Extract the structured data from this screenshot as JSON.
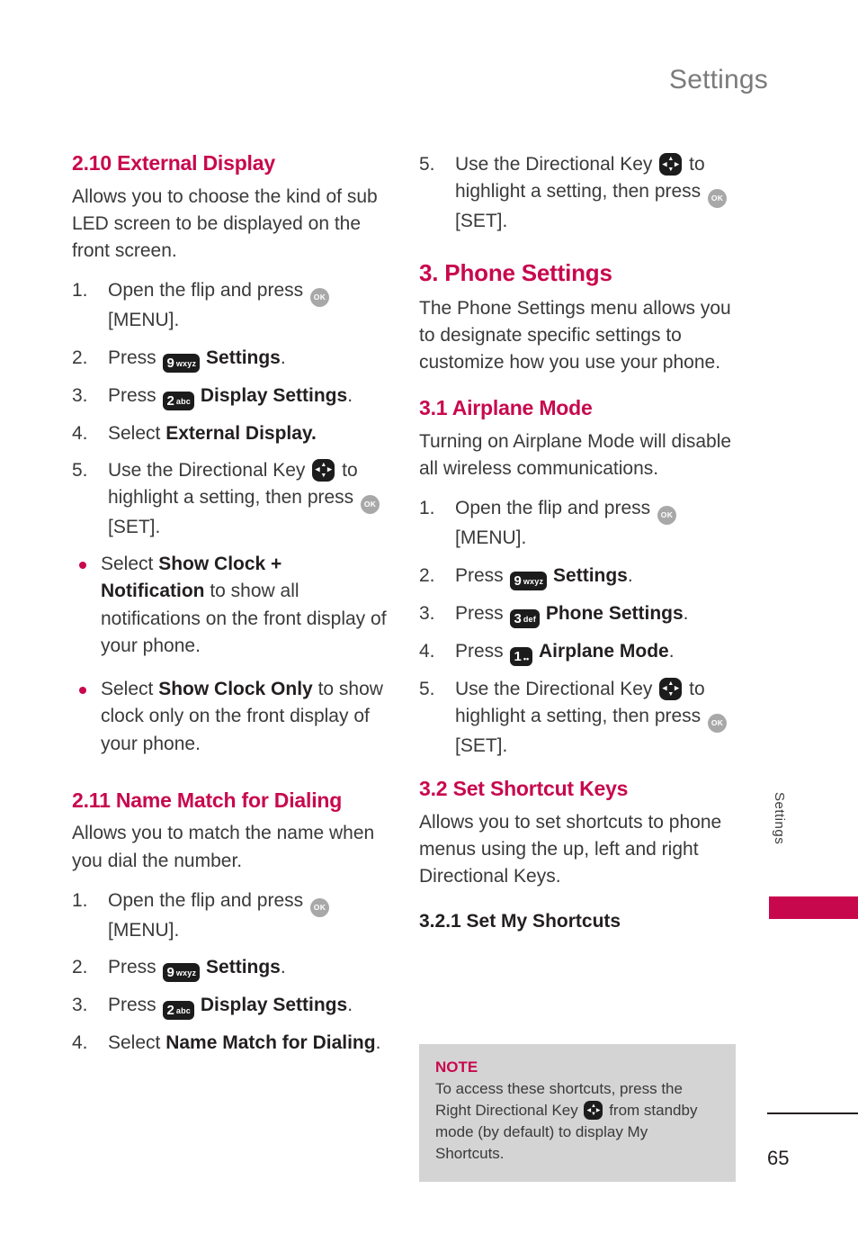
{
  "header": {
    "title": "Settings"
  },
  "side_tab": {
    "label": "Settings",
    "block_color": "#c8084d"
  },
  "footer": {
    "page_number": "65"
  },
  "icons": {
    "ok_key": "OK",
    "key9": {
      "digit": "9",
      "letters": "wxyz"
    },
    "key2": {
      "digit": "2",
      "letters": "abc"
    },
    "key3": {
      "digit": "3",
      "letters": "def"
    },
    "key1": {
      "digit": "1",
      "letters": "••"
    }
  },
  "left_column": {
    "section_210": {
      "heading": "2.10 External Display",
      "intro": "Allows you to choose the kind of sub LED screen to be displayed on the front screen.",
      "steps": [
        {
          "num": "1.",
          "pre": "Open the flip and press ",
          "icon": "ok",
          "post": " [MENU]."
        },
        {
          "num": "2.",
          "pre": "Press ",
          "icon": "key9",
          "post": " ",
          "bold": "Settings",
          "tail": "."
        },
        {
          "num": "3.",
          "pre": "Press ",
          "icon": "key2",
          "post": " ",
          "bold": "Display Settings",
          "tail": "."
        },
        {
          "num": "4.",
          "pre": "Select ",
          "icon": "none",
          "bold": "External Display.",
          "tail": ""
        },
        {
          "num": "5.",
          "pre": "Use the Directional Key ",
          "icon": "dir",
          "post": " to highlight a setting, then press ",
          "icon2": "ok",
          "post2": " [SET]."
        }
      ],
      "bullets": [
        {
          "pre": "Select ",
          "bold": "Show Clock + Notification",
          "post": " to show all notifications on the front display of your phone."
        },
        {
          "pre": "Select ",
          "bold": "Show Clock Only",
          "post": " to show clock only on the front display of your phone."
        }
      ]
    },
    "section_211": {
      "heading": "2.11 Name Match for Dialing",
      "intro": "Allows you to match the name when you dial the number.",
      "steps": [
        {
          "num": "1.",
          "pre": "Open the flip and press ",
          "icon": "ok",
          "post": " [MENU]."
        },
        {
          "num": "2.",
          "pre": "Press ",
          "icon": "key9",
          "post": " ",
          "bold": "Settings",
          "tail": "."
        },
        {
          "num": "3.",
          "pre": "Press ",
          "icon": "key2",
          "post": " ",
          "bold": "Display Settings",
          "tail": "."
        },
        {
          "num": "4.",
          "pre": "Select ",
          "icon": "none",
          "bold": "Name Match for Dialing",
          "tail": "."
        }
      ]
    }
  },
  "right_column": {
    "step5_top": {
      "num": "5.",
      "pre": "Use the Directional Key ",
      "post": " to highlight a setting, then press ",
      "post2": " [SET]."
    },
    "section_3": {
      "heading": "3. Phone Settings",
      "intro": "The Phone Settings menu allows you to designate specific settings to customize how you use your phone."
    },
    "section_31": {
      "heading": "3.1 Airplane Mode",
      "intro": "Turning on Airplane Mode will disable all wireless communications.",
      "steps": [
        {
          "num": "1.",
          "pre": "Open the flip and press ",
          "icon": "ok",
          "post": " [MENU]."
        },
        {
          "num": "2.",
          "pre": "Press ",
          "icon": "key9",
          "post": " ",
          "bold": "Settings",
          "tail": "."
        },
        {
          "num": "3.",
          "pre": "Press ",
          "icon": "key3",
          "post": " ",
          "bold": "Phone Settings",
          "tail": "."
        },
        {
          "num": "4.",
          "pre": "Press ",
          "icon": "key1",
          "post": " ",
          "bold": "Airplane Mode",
          "tail": "."
        },
        {
          "num": "5.",
          "pre": "Use the Directional Key ",
          "icon": "dir",
          "post": " to highlight a setting, then press ",
          "icon2": "ok",
          "post2": " [SET]."
        }
      ]
    },
    "section_32": {
      "heading": "3.2 Set Shortcut Keys",
      "intro": "Allows you to set shortcuts to phone menus using the up, left and right Directional Keys."
    },
    "section_321": {
      "heading": "3.2.1 Set My Shortcuts"
    },
    "note": {
      "title": "NOTE",
      "part1": "To access these shortcuts, press the Right Directional Key ",
      "part2": " from standby mode (by default) to display My Shortcuts."
    }
  }
}
